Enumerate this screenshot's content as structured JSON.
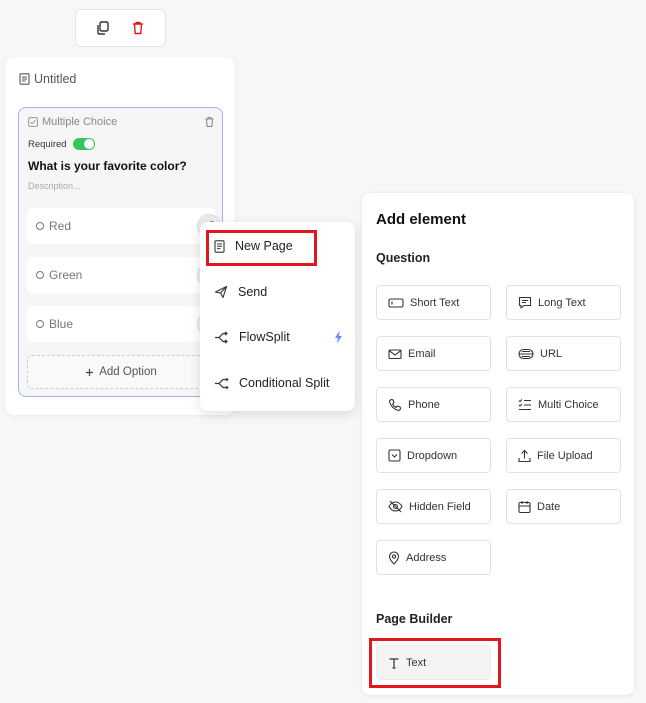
{
  "toolbar": {
    "copy_icon": "copy-icon",
    "delete_icon": "trash-icon",
    "delete_color": "#e0171c"
  },
  "page": {
    "title": "Untitled"
  },
  "question": {
    "type_label": "Multiple Choice",
    "required_label": "Required",
    "required_on": true,
    "toggle_color": "#34c759",
    "text": "What is your favorite color?",
    "description_placeholder": "Description...",
    "options": [
      "Red",
      "Green",
      "Blue"
    ],
    "add_option_label": "Add Option"
  },
  "menu": {
    "items": [
      {
        "label": "New Page",
        "icon": "page-icon"
      },
      {
        "label": "Send",
        "icon": "send-icon"
      },
      {
        "label": "FlowSplit",
        "icon": "split-icon",
        "badge_icon": "lightning-icon"
      },
      {
        "label": "Conditional Split",
        "icon": "conditional-split-icon"
      }
    ]
  },
  "panel": {
    "title": "Add element",
    "question_section": "Question",
    "question_elements": [
      {
        "label": "Short Text",
        "icon": "short-text-icon"
      },
      {
        "label": "Long Text",
        "icon": "long-text-icon"
      },
      {
        "label": "Email",
        "icon": "mail-icon"
      },
      {
        "label": "URL",
        "icon": "globe-icon"
      },
      {
        "label": "Phone",
        "icon": "phone-icon"
      },
      {
        "label": "Multi Choice",
        "icon": "list-check-icon"
      },
      {
        "label": "Dropdown",
        "icon": "dropdown-icon"
      },
      {
        "label": "File Upload",
        "icon": "upload-icon"
      },
      {
        "label": "Hidden Field",
        "icon": "eye-off-icon"
      },
      {
        "label": "Date",
        "icon": "calendar-icon"
      },
      {
        "label": "Address",
        "icon": "location-pin-icon"
      }
    ],
    "page_builder_section": "Page Builder",
    "page_builder_elements": [
      {
        "label": "Text",
        "icon": "text-icon"
      }
    ]
  },
  "colors": {
    "highlight": "#e0171c",
    "selected_border": "#9fb5e8",
    "accent_bolt": "#6b8cff"
  }
}
